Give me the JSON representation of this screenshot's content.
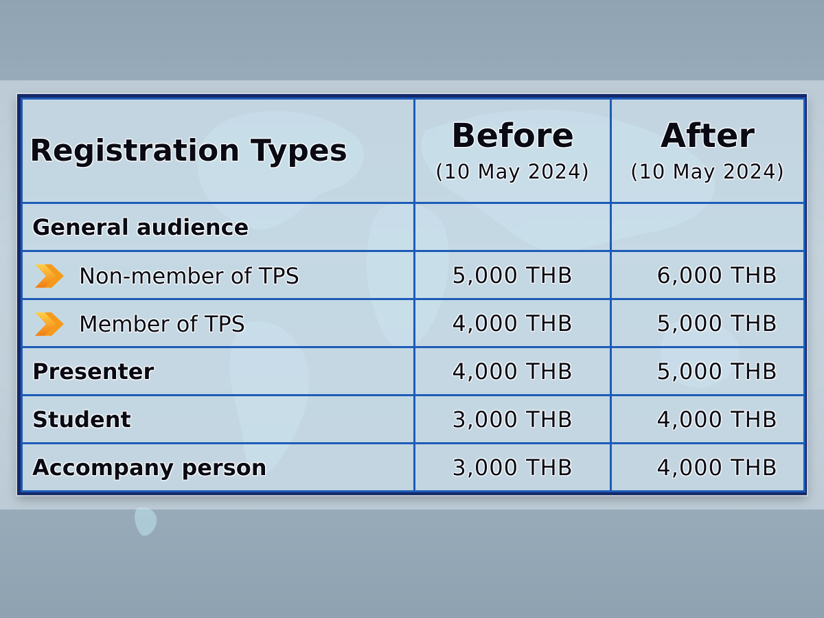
{
  "colors": {
    "border_outer": "#14286a",
    "border_inner": "#1d5bb8",
    "arrow": "#f39a1c",
    "text": "#0a0a14"
  },
  "table": {
    "header": {
      "title": "Registration Types",
      "before_label": "Before",
      "before_date": "(10 May 2024)",
      "after_label": "After",
      "after_date": "(10 May 2024)"
    },
    "rows": [
      {
        "label": "General audience",
        "before": "",
        "after": "",
        "style": "bold"
      },
      {
        "label": "Non-member of TPS",
        "before": "5,000 THB",
        "after": "6,000 THB",
        "style": "sub",
        "icon": "chevron-right-icon"
      },
      {
        "label": "Member of TPS",
        "before": "4,000 THB",
        "after": "5,000 THB",
        "style": "sub",
        "icon": "chevron-right-icon"
      },
      {
        "label": "Presenter",
        "before": "4,000 THB",
        "after": "5,000 THB",
        "style": "bold"
      },
      {
        "label": "Student",
        "before": "3,000 THB",
        "after": "4,000 THB",
        "style": "bold"
      },
      {
        "label": "Accompany person",
        "before": "3,000 THB",
        "after": "4,000 THB",
        "style": "bold"
      }
    ]
  }
}
